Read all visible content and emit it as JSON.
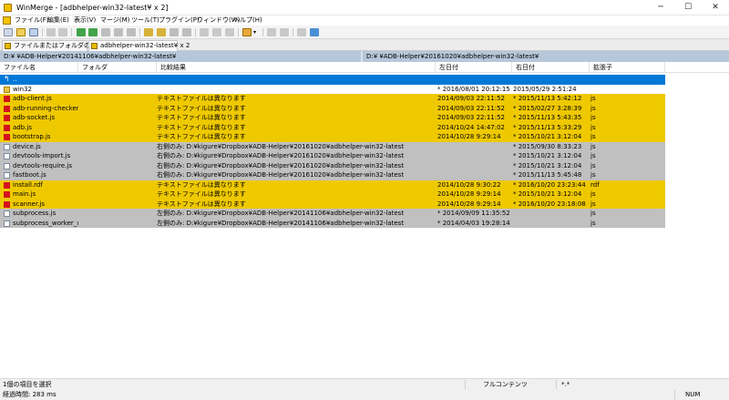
{
  "window": {
    "title": "WinMerge - [adbhelper-win32-latest¥ x 2]"
  },
  "menu": [
    "ファイル(F)",
    "編集(E)",
    "表示(V)",
    "マージ(M)",
    "ツール(T)",
    "プラグイン(P)",
    "ウィンドウ(W)",
    "ヘルプ(H)"
  ],
  "tabs": [
    {
      "label": "ファイルまたはフォルダの選択..."
    },
    {
      "label": "adbhelper-win32-latest¥ x 2"
    }
  ],
  "paths": {
    "left": "D:¥              ¥ADB-Helper¥20141106¥adbhelper-win32-latest¥",
    "right": "D:¥              ¥ADB-Helper¥20161020¥adbhelper-win32-latest¥"
  },
  "columns": [
    "ファイル名",
    "フォルダ",
    "比較結果",
    "左日付",
    "右日付",
    "拡張子"
  ],
  "rows": [
    {
      "name": "..",
      "folder": "",
      "result": "",
      "ldate": "",
      "rdate": "",
      "ext": "",
      "kind": "selected",
      "icon": "up-icon"
    },
    {
      "name": "win32",
      "folder": "",
      "result": "",
      "ldate": "* 2016/08/01 20:12:15",
      "rdate": "2015/05/29 2:51:24",
      "ext": "",
      "kind": "plain",
      "icon": "folder-icon"
    },
    {
      "name": "adb-client.js",
      "folder": "",
      "result": "テキストファイルは異なります",
      "ldate": "2014/09/03 22:11:52",
      "rdate": "* 2015/11/13 5:42:12",
      "ext": "js",
      "kind": "diff",
      "icon": "file-diff-icon"
    },
    {
      "name": "adb-running-checker.js",
      "folder": "",
      "result": "テキストファイルは異なります",
      "ldate": "2014/09/03 22:11:52",
      "rdate": "* 2015/02/27 3:28:39",
      "ext": "js",
      "kind": "diff",
      "icon": "file-diff-icon"
    },
    {
      "name": "adb-socket.js",
      "folder": "",
      "result": "テキストファイルは異なります",
      "ldate": "2014/09/03 22:11:52",
      "rdate": "* 2015/11/13 5:43:35",
      "ext": "js",
      "kind": "diff",
      "icon": "file-diff-icon"
    },
    {
      "name": "adb.js",
      "folder": "",
      "result": "テキストファイルは異なります",
      "ldate": "2014/10/24 14:47:02",
      "rdate": "* 2015/11/13 5:33:29",
      "ext": "js",
      "kind": "diff",
      "icon": "file-diff-icon"
    },
    {
      "name": "bootstrap.js",
      "folder": "",
      "result": "テキストファイルは異なります",
      "ldate": "2014/10/28 9:29:14",
      "rdate": "* 2015/10/21 3:12:04",
      "ext": "js",
      "kind": "diff",
      "icon": "file-diff-icon"
    },
    {
      "name": "device.js",
      "folder": "",
      "result": "右側のみ: D:¥kigure¥Dropbox¥ADB-Helper¥20161020¥adbhelper-win32-latest",
      "ldate": "",
      "rdate": "* 2015/09/30 8:33:23",
      "ext": "js",
      "kind": "unique",
      "icon": "file-unique-icon"
    },
    {
      "name": "devtools-import.js",
      "folder": "",
      "result": "右側のみ: D:¥kigure¥Dropbox¥ADB-Helper¥20161020¥adbhelper-win32-latest",
      "ldate": "",
      "rdate": "* 2015/10/21 3:12:04",
      "ext": "js",
      "kind": "unique",
      "icon": "file-unique-icon"
    },
    {
      "name": "devtools-require.js",
      "folder": "",
      "result": "右側のみ: D:¥kigure¥Dropbox¥ADB-Helper¥20161020¥adbhelper-win32-latest",
      "ldate": "",
      "rdate": "* 2015/10/21 3:12:04",
      "ext": "js",
      "kind": "unique",
      "icon": "file-unique-icon"
    },
    {
      "name": "fastboot.js",
      "folder": "",
      "result": "右側のみ: D:¥kigure¥Dropbox¥ADB-Helper¥20161020¥adbhelper-win32-latest",
      "ldate": "",
      "rdate": "* 2015/11/13 5:45:48",
      "ext": "js",
      "kind": "unique",
      "icon": "file-unique-icon"
    },
    {
      "name": "install.rdf",
      "folder": "",
      "result": "テキストファイルは異なります",
      "ldate": "2014/10/28 9:30:22",
      "rdate": "* 2016/10/20 23:23:44",
      "ext": "rdf",
      "kind": "diff",
      "icon": "file-diff-icon"
    },
    {
      "name": "main.js",
      "folder": "",
      "result": "テキストファイルは異なります",
      "ldate": "2014/10/28 9:29:14",
      "rdate": "* 2015/10/21 3:12:04",
      "ext": "js",
      "kind": "diff",
      "icon": "file-diff-icon"
    },
    {
      "name": "scanner.js",
      "folder": "",
      "result": "テキストファイルは異なります",
      "ldate": "2014/10/28 9:29:14",
      "rdate": "* 2016/10/20 23:18:08",
      "ext": "js",
      "kind": "diff",
      "icon": "file-diff-icon"
    },
    {
      "name": "subprocess.js",
      "folder": "",
      "result": "左側のみ: D:¥kigure¥Dropbox¥ADB-Helper¥20141106¥adbhelper-win32-latest",
      "ldate": "* 2014/09/09 11:35:52",
      "rdate": "",
      "ext": "js",
      "kind": "unique",
      "icon": "file-unique-icon"
    },
    {
      "name": "subprocess_worker_wi...",
      "folder": "",
      "result": "左側のみ: D:¥kigure¥Dropbox¥ADB-Helper¥20141106¥adbhelper-win32-latest",
      "ldate": "* 2014/04/03 19:28:14",
      "rdate": "",
      "ext": "js",
      "kind": "unique",
      "icon": "file-unique-icon"
    }
  ],
  "status": {
    "selection": "1個の項目を選択",
    "elapsed": "経過時間: 283 ms",
    "compare_mode": "フルコンテンツ",
    "filter": "*.*",
    "num": "NUM"
  },
  "colors": {
    "diff_row": "#efc900",
    "unique_row": "#c0c0c0",
    "selected_row": "#0078d7",
    "path_bar": "#b6c7da"
  }
}
